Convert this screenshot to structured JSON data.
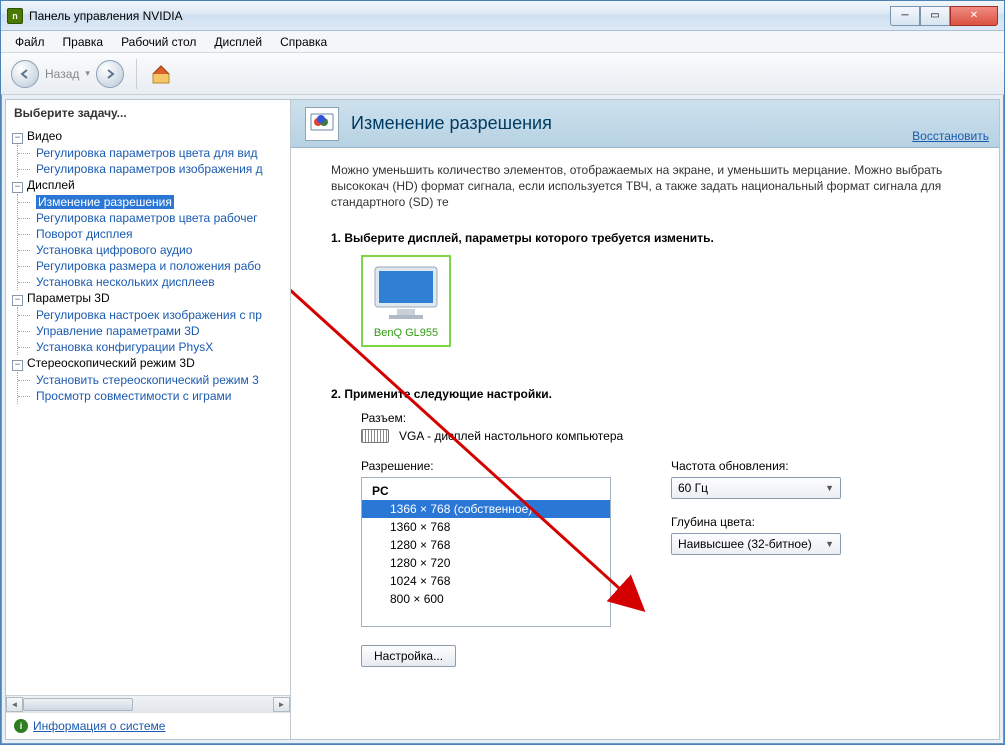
{
  "window": {
    "title": "Панель управления NVIDIA"
  },
  "menu": {
    "file": "Файл",
    "edit": "Правка",
    "desktop": "Рабочий стол",
    "display": "Дисплей",
    "help": "Справка"
  },
  "toolbar": {
    "back": "Назад"
  },
  "sidebar": {
    "header": "Выберите задачу...",
    "groups": [
      {
        "label": "Видео",
        "items": [
          "Регулировка параметров цвета для вид",
          "Регулировка параметров изображения д"
        ]
      },
      {
        "label": "Дисплей",
        "items": [
          "Изменение разрешения",
          "Регулировка параметров цвета рабочег",
          "Поворот дисплея",
          "Установка цифрового аудио",
          "Регулировка размера и положения рабо",
          "Установка нескольких дисплеев"
        ]
      },
      {
        "label": "Параметры 3D",
        "items": [
          "Регулировка настроек изображения с пр",
          "Управление параметрами 3D",
          "Установка конфигурации PhysX"
        ]
      },
      {
        "label": "Стереоскопический режим 3D",
        "items": [
          "Установить стереоскопический режим 3",
          "Просмотр совместимости с играми"
        ]
      }
    ],
    "selected": "Изменение разрешения",
    "sysinfo": "Информация о системе"
  },
  "page": {
    "title": "Изменение разрешения",
    "restore": "Восстановить",
    "description": "Можно уменьшить количество элементов, отображаемых на экране, и уменьшить мерцание. Можно выбрать высококач (HD) формат сигнала, если используется ТВЧ, а также задать национальный формат сигнала для стандартного (SD) те",
    "step1": "1. Выберите дисплей, параметры которого требуется изменить.",
    "monitor_name": "BenQ GL955",
    "step2": "2. Примените следующие настройки.",
    "connector_label": "Разъем:",
    "connector_value": "VGA - дисплей настольного компьютера",
    "resolution_label": "Разрешение:",
    "res_group": "PC",
    "resolutions": [
      "1366 × 768 (собственное)",
      "1360 × 768",
      "1280 × 768",
      "1280 × 720",
      "1024 × 768",
      "800 × 600"
    ],
    "res_selected": "1366 × 768 (собственное)",
    "refresh_label": "Частота обновления:",
    "refresh_value": "60 Гц",
    "depth_label": "Глубина цвета:",
    "depth_value": "Наивысшее (32-битное)",
    "configure_btn": "Настройка..."
  }
}
